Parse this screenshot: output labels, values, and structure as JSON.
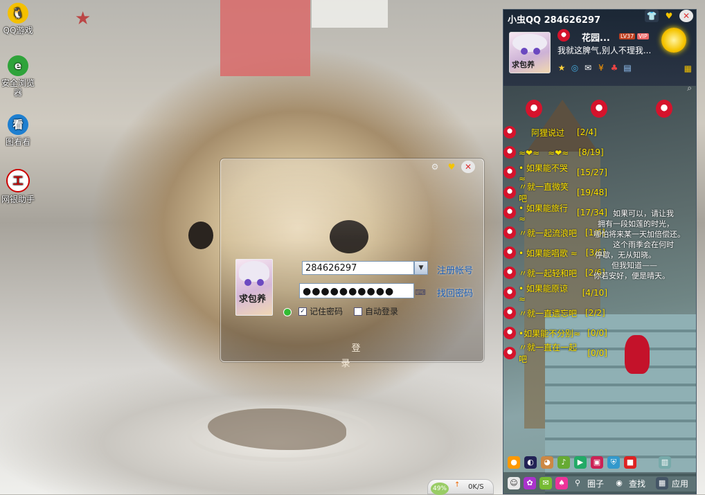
{
  "desktop": {
    "icons": [
      {
        "label": "QQ游戏",
        "icon": "qq-game-icon"
      },
      {
        "label": "安全浏览器",
        "icon": "browser-icon"
      },
      {
        "label": "图看看",
        "icon": "image-viewer-icon"
      },
      {
        "label": "网银助手",
        "icon": "bank-helper-icon"
      }
    ]
  },
  "login": {
    "username": "284626297",
    "password_mask": "●●●●●●●●●●",
    "register_link": "注册帐号",
    "recover_link": "找回密码",
    "remember_label": "记住密码",
    "remember_checked": true,
    "autologin_label": "自动登录",
    "autologin_checked": false,
    "login_button": "登 录",
    "avatar_text": "求包养"
  },
  "qq": {
    "title": "小虫QQ 284626297",
    "nickname": "花园...",
    "level_badge": "LV37",
    "vip_badge": "VIP",
    "signature": "我就这脾气,别人不理我...",
    "avatar_text": "求包养",
    "groups": [
      {
        "name": "阿狸说过",
        "count": "[2/4]"
      },
      {
        "name": "≈❤≈　≈❤≈",
        "count": "[8/19]"
      },
      {
        "name": "• 如果能不哭 ≈",
        "count": "[15/27]"
      },
      {
        "name": "〃就一直微笑吧",
        "count": "[19/48]"
      },
      {
        "name": "• 如果能旅行 ≈",
        "count": "[17/34]"
      },
      {
        "name": "〃就一起流浪吧",
        "count": "[1/6]"
      },
      {
        "name": "• 如果能唱歌 ≈",
        "count": "[3/6]"
      },
      {
        "name": "〃就一起轻和吧",
        "count": "[2/6]"
      },
      {
        "name": "• 如果能原谅 ≈",
        "count": "[4/10]"
      },
      {
        "name": "〃就一直遗忘吧",
        "count": "[2/2]"
      },
      {
        "name": "•如果能不分别≈",
        "count": "[0/0]"
      },
      {
        "name": "〃就一直在一起吧",
        "count": "[0/0]"
      }
    ],
    "poem": [
      "如果可以，请让我",
      "拥有一段如莲的时光，",
      "哪怕将来某一天加倍偿还。",
      "这个雨季会在何时",
      "停歇，无从知晓。",
      "但我知道——",
      "你若安好，便是晴天。"
    ],
    "bottom": {
      "circle_label": "圈子",
      "search_label": "查找",
      "apps_label": "应用"
    }
  },
  "taskbar": {
    "cpu_percent": "49%",
    "net_speed": "0K/S"
  },
  "colors": {
    "link": "#1b5fb8",
    "group_text": "#ffe400",
    "panel_bg": "#1e2a3a"
  }
}
